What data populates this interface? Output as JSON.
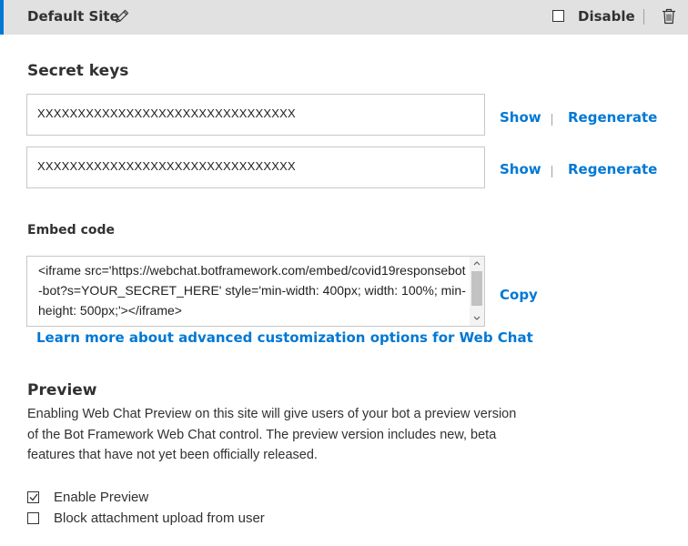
{
  "header": {
    "site_name": "Default Site",
    "edit_icon": "pencil-icon",
    "disable_label": "Disable",
    "disable_checked": false,
    "delete_icon": "trash-icon",
    "accent_color": "#0078d4"
  },
  "secret_keys": {
    "title": "Secret keys",
    "keys": [
      {
        "value": "XXXXXXXXXXXXXXXXXXXXXXXXXXXXXXXX",
        "show_label": "Show",
        "regenerate_label": "Regenerate"
      },
      {
        "value": "XXXXXXXXXXXXXXXXXXXXXXXXXXXXXXXX",
        "show_label": "Show",
        "regenerate_label": "Regenerate"
      }
    ]
  },
  "embed": {
    "label": "Embed code",
    "code": "<iframe src='https://webchat.botframework.com/embed/covid19responsebot-bot?s=YOUR_SECRET_HERE'  style='min-width: 400px; width: 100%; min-height: 500px;'></iframe>",
    "copy_label": "Copy",
    "learn_more": "Learn more about advanced customization options for Web Chat"
  },
  "preview": {
    "title": "Preview",
    "description": "Enabling Web Chat Preview on this site will give users of your bot a preview version of the Bot Framework Web Chat control. The preview version includes new, beta features that have not yet been officially released.",
    "options": [
      {
        "label": "Enable Preview",
        "checked": true
      },
      {
        "label": "Block attachment upload from user",
        "checked": false
      }
    ]
  }
}
